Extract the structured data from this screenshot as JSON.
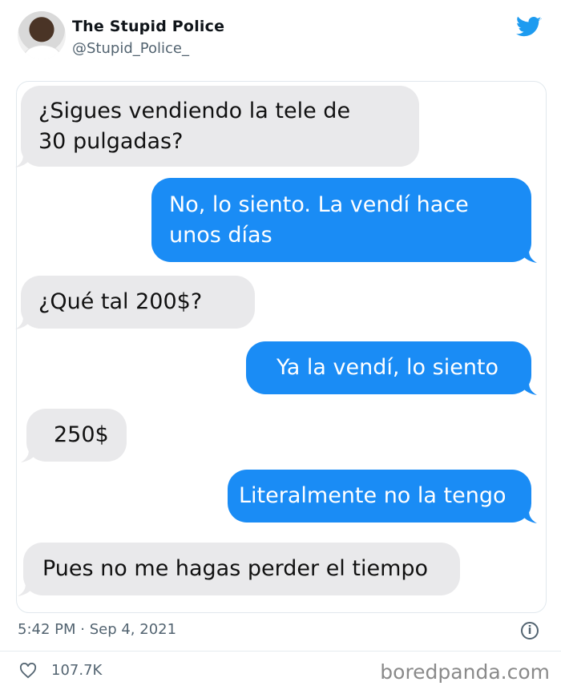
{
  "tweet": {
    "author_name": "The Stupid Police",
    "author_handle": "@Stupid_Police_",
    "timestamp": "5:42 PM · Sep 4, 2021",
    "likes": "107.7K"
  },
  "messages": [
    {
      "direction": "received",
      "lines": [
        "¿Sigues vendiendo la tele de",
        "30 pulgadas?"
      ]
    },
    {
      "direction": "sent",
      "lines": [
        "No, lo siento. La vendí hace",
        "unos días"
      ]
    },
    {
      "direction": "received",
      "lines": [
        "¿Qué tal 200$?"
      ]
    },
    {
      "direction": "sent",
      "lines": [
        "Ya la vendí, lo siento"
      ]
    },
    {
      "direction": "received",
      "lines": [
        "250$"
      ]
    },
    {
      "direction": "sent",
      "lines": [
        "Literalmente no la tengo"
      ]
    },
    {
      "direction": "received",
      "lines": [
        "Pues no me hagas perder el tiempo"
      ]
    }
  ],
  "watermark": "boredpanda.com",
  "colors": {
    "sent_bubble": "#1a8cf5",
    "received_bubble": "#e9e9eb",
    "twitter_blue": "#1d9bf0"
  },
  "icons": {
    "bird": "twitter-bird-icon",
    "info": "info-icon",
    "like": "heart-icon"
  }
}
